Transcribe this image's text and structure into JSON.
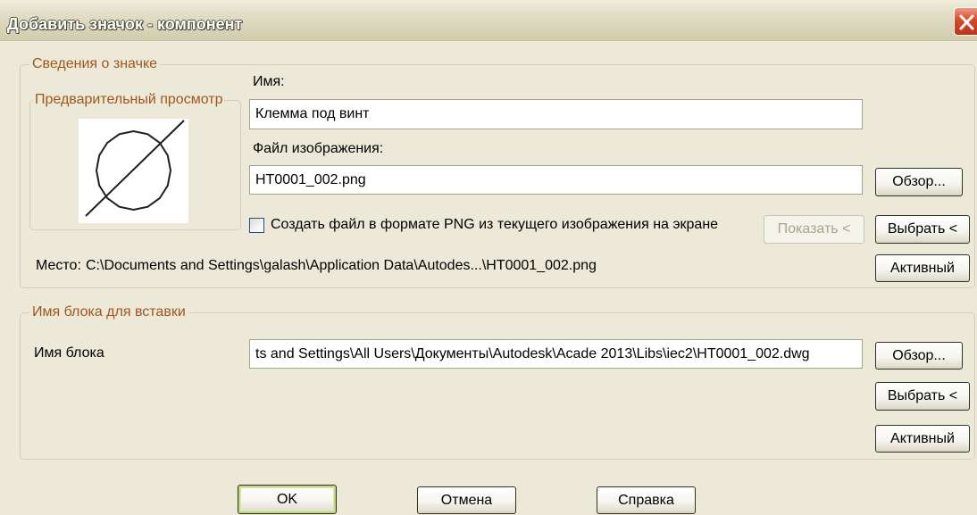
{
  "window": {
    "title": "Добавить значок - компонент",
    "close_icon": "close-icon"
  },
  "icon_info": {
    "group_label": "Сведения о значке",
    "preview": {
      "group_label": "Предварительный просмотр",
      "symbol_icon": "circle-slash-icon"
    },
    "name": {
      "label": "Имя:",
      "value": "Клемма под винт"
    },
    "image_file": {
      "label": "Файл изображения:",
      "value": "HT0001_002.png",
      "browse_label": "Обзор..."
    },
    "create_png": {
      "label": "Создать файл в формате PNG из текущего изображения на экране",
      "checked": false,
      "show_label": "Показать <",
      "show_enabled": false,
      "select_label": "Выбрать <"
    },
    "location": {
      "label": "Место:",
      "value": "C:\\Documents and Settings\\galash\\Application Data\\Autodes...\\HT0001_002.png",
      "active_label": "Активный"
    }
  },
  "block": {
    "group_label": "Имя блока для вставки",
    "name_label": "Имя блока",
    "name_value": "ts and Settings\\All Users\\Документы\\Autodesk\\Acade 2013\\Libs\\iec2\\HT0001_002.dwg",
    "browse_label": "Обзор...",
    "select_label": "Выбрать <",
    "active_label": "Активный"
  },
  "footer": {
    "ok_label": "OK",
    "cancel_label": "Отмена",
    "help_label": "Справка"
  },
  "colors": {
    "dialog_face": "#ECE9D8",
    "group_caption": "#A0561C",
    "group_border": "#D0CFBF",
    "close_button": "#D7482A",
    "disabled_text": "#A7A48E"
  }
}
